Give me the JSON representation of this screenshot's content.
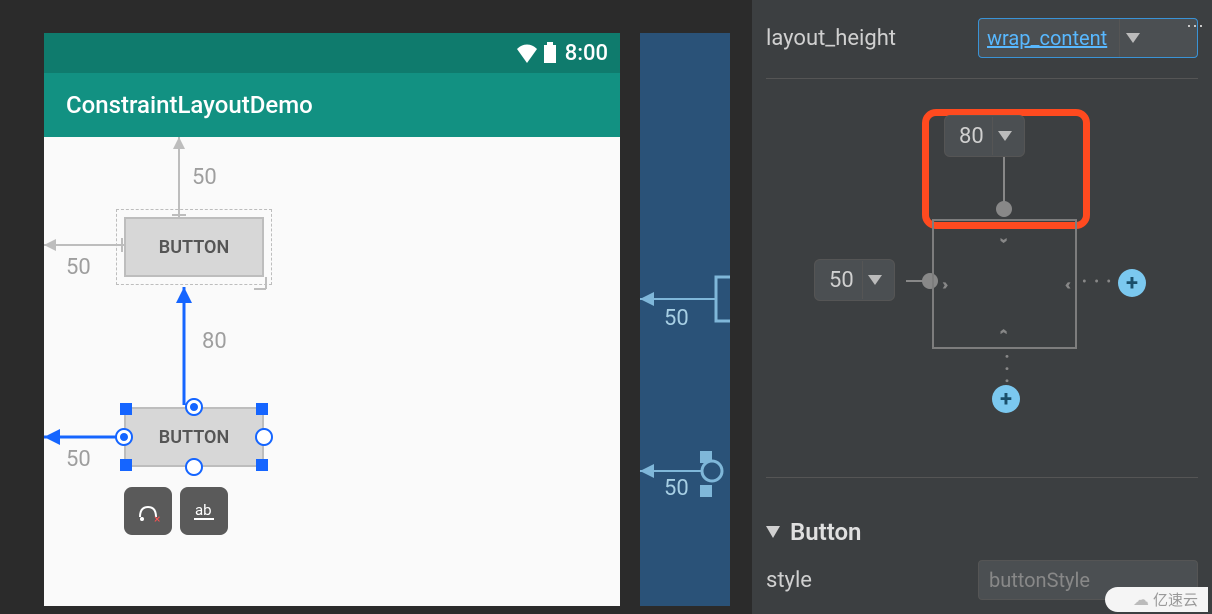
{
  "statusbar": {
    "time": "8:00"
  },
  "appbar": {
    "title": "ConstraintLayoutDemo"
  },
  "buttons": {
    "b1": "BUTTON",
    "b2": "BUTTON"
  },
  "margins": {
    "b1_top": "50",
    "b1_left": "50",
    "b2_top": "80",
    "b2_left": "50",
    "bp_b1_left": "50",
    "bp_b2_left": "50"
  },
  "properties": {
    "layout_height_label": "layout_height",
    "layout_height_value": "wrap_content",
    "margin_top": "80",
    "margin_left": "50",
    "section_button": "Button",
    "style_label": "style",
    "style_value": "buttonStyle"
  },
  "watermark": "亿速云"
}
